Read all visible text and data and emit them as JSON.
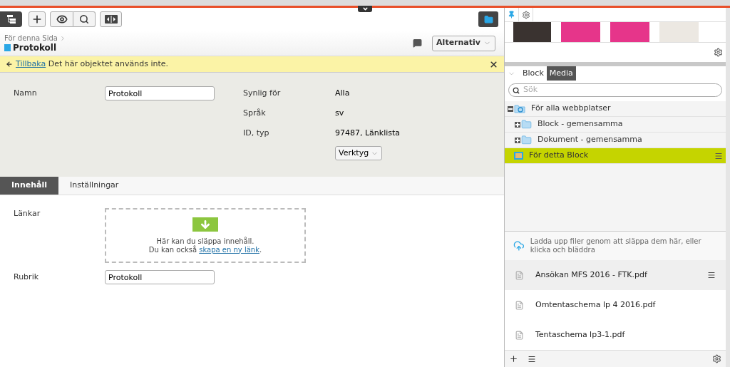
{
  "breadcrumb": {
    "parent": "För denna Sida",
    "title": "Protokoll"
  },
  "options_button": "Alternativ",
  "notice": {
    "link": "Tillbaka",
    "text": "Det här objektet används inte."
  },
  "properties": {
    "name_label": "Namn",
    "name_value": "Protokoll",
    "info": [
      {
        "label": "Synlig för",
        "value": "Alla"
      },
      {
        "label": "Språk",
        "value": "sv"
      },
      {
        "label": "ID, typ",
        "value": "97487, Länklista"
      }
    ],
    "tools_button": "Verktyg"
  },
  "tabs": [
    {
      "label": "Innehåll",
      "selected": true
    },
    {
      "label": "Inställningar",
      "selected": false
    }
  ],
  "content": {
    "links_label": "Länkar",
    "drop_text": "Här kan du släppa innehåll.",
    "drop_prefix": "Du kan också",
    "drop_link": "skapa en ny länk",
    "drop_suffix": ".",
    "heading_label": "Rubrik",
    "heading_value": "Protokoll"
  },
  "assets": {
    "tabs": [
      {
        "label": "Block",
        "selected": false
      },
      {
        "label": "Media",
        "selected": true
      }
    ],
    "search_placeholder": "Sök",
    "tree": [
      {
        "label": "För alla webbplatser",
        "kind": "global",
        "expanded": true,
        "selected": false,
        "children": [
          {
            "label": "Block - gemensamma",
            "kind": "folder",
            "expanded": false,
            "selected": false
          },
          {
            "label": "Dokument - gemensamma",
            "kind": "folder",
            "expanded": false,
            "selected": false
          }
        ]
      },
      {
        "label": "För detta Block",
        "kind": "local",
        "selected": true
      }
    ],
    "upload_text": "Ladda upp filer genom att släppa dem här, eller klicka och bläddra",
    "files": [
      {
        "name": "Ansökan MFS 2016 - FTK.pdf",
        "selected": true
      },
      {
        "name": "Omtentaschema lp 4 2016.pdf",
        "selected": false
      },
      {
        "name": "Tentaschema lp3-1.pdf",
        "selected": false
      }
    ]
  }
}
